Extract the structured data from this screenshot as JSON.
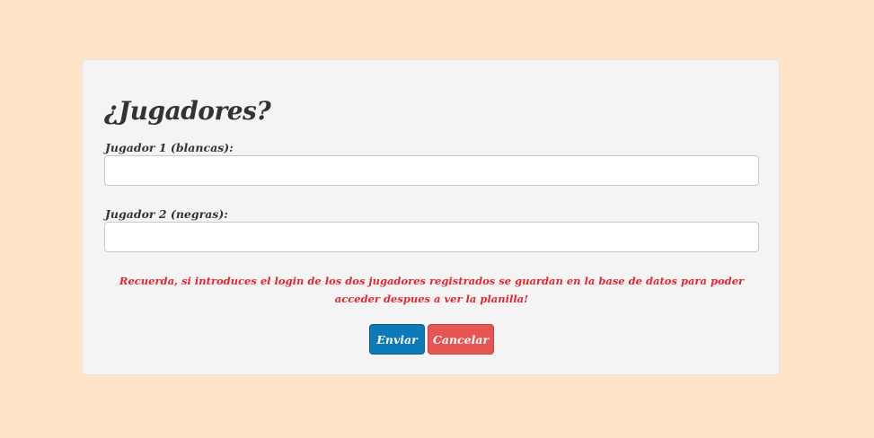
{
  "form": {
    "title": "¿Jugadores?",
    "player1_label": "Jugador 1 (blancas):",
    "player1_value": "",
    "player2_label": "Jugador 2 (negras):",
    "player2_value": "",
    "notice": "Recuerda, si introduces el login de los dos jugadores registrados se guardan en la base de datos para poder acceder despues a ver la planilla!",
    "send_label": "Enviar",
    "cancel_label": "Cancelar"
  },
  "colors": {
    "page_background": "#ffe4c7",
    "card_background": "#f4f4f4",
    "notice_text": "#e8252d",
    "send_button": "#0d7ab8",
    "cancel_button": "#e75454"
  }
}
